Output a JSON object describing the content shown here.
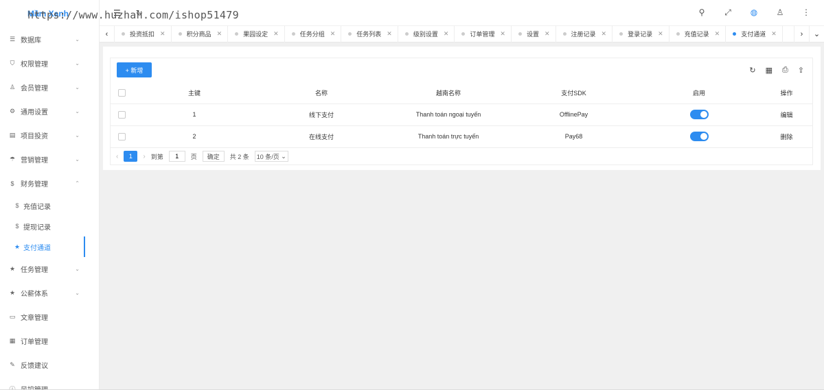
{
  "brand": "Mầm Xanh",
  "watermark": "https://www.huzhan.com/ishop51479",
  "sidebar": {
    "items": [
      {
        "label": "数据库",
        "icon": "database-icon",
        "glyph": "☰",
        "arrow": "⌄"
      },
      {
        "label": "权限管理",
        "icon": "shield-icon",
        "glyph": "⛉",
        "arrow": "⌄"
      },
      {
        "label": "会员管理",
        "icon": "user-icon",
        "glyph": "♙",
        "arrow": "⌄"
      },
      {
        "label": "通用设置",
        "icon": "gear-icon",
        "glyph": "⚙",
        "arrow": "⌄"
      },
      {
        "label": "项目投资",
        "icon": "chart-icon",
        "glyph": "▤",
        "arrow": "⌄"
      },
      {
        "label": "营销管理",
        "icon": "bell-icon",
        "glyph": "☂",
        "arrow": "⌄"
      },
      {
        "label": "财务管理",
        "icon": "dollar-icon",
        "glyph": "$",
        "arrow": "⌃"
      }
    ],
    "sub_items": [
      {
        "label": "充值记录",
        "icon": "dollar-icon",
        "glyph": "$"
      },
      {
        "label": "提现记录",
        "icon": "dollar-icon",
        "glyph": "$"
      },
      {
        "label": "支付通道",
        "icon": "star-icon",
        "glyph": "★"
      }
    ],
    "items_after": [
      {
        "label": "任务管理",
        "icon": "star-icon",
        "glyph": "★",
        "arrow": "⌄"
      },
      {
        "label": "公薪体系",
        "icon": "star-icon",
        "glyph": "★",
        "arrow": "⌄"
      },
      {
        "label": "文章管理",
        "icon": "book-icon",
        "glyph": "▭",
        "arrow": ""
      },
      {
        "label": "订单管理",
        "icon": "calendar-icon",
        "glyph": "▦",
        "arrow": ""
      },
      {
        "label": "反馈建议",
        "icon": "feedback-icon",
        "glyph": "✎",
        "arrow": ""
      },
      {
        "label": "风控管理",
        "icon": "info-icon",
        "glyph": "ⓘ",
        "arrow": "⌄"
      }
    ]
  },
  "header": {
    "menu_glyph": "☰",
    "refresh_glyph": "↻",
    "icons": [
      {
        "name": "search-icon",
        "glyph": "⚲"
      },
      {
        "name": "fullscreen-icon",
        "glyph": "⤢"
      },
      {
        "name": "globe-icon",
        "glyph": "◍"
      },
      {
        "name": "user-icon",
        "glyph": "♙"
      },
      {
        "name": "more-icon",
        "glyph": "⋮"
      }
    ]
  },
  "tabs": {
    "prev": "‹",
    "next": "›",
    "dropdown": "⌄",
    "items": [
      "投资抵扣",
      "积分商品",
      "果园设定",
      "任务分组",
      "任务列表",
      "级别设置",
      "订单管理",
      "设置",
      "注册记录",
      "登录记录",
      "充值记录",
      "支付通道"
    ],
    "active_index": 11,
    "close": "✕"
  },
  "toolbar": {
    "add_label": "+ 新增",
    "tools": [
      {
        "name": "refresh-icon",
        "glyph": "↻"
      },
      {
        "name": "columns-icon",
        "glyph": "▦"
      },
      {
        "name": "print-icon",
        "glyph": "⎙"
      },
      {
        "name": "export-icon",
        "glyph": "⇪"
      }
    ]
  },
  "table": {
    "columns": [
      "主键",
      "名称",
      "越南名称",
      "支付SDK",
      "启用",
      "操作"
    ],
    "rows": [
      {
        "id": "1",
        "name": "线下支付",
        "vn_name": "Thanh toán ngoại tuyến",
        "sdk": "OfflinePay",
        "enabled": true,
        "action": "编辑"
      },
      {
        "id": "2",
        "name": "在线支付",
        "vn_name": "Thanh toán trực tuyến",
        "sdk": "Pay68",
        "enabled": true,
        "action": "删除"
      }
    ]
  },
  "pager": {
    "prev": "‹",
    "current": "1",
    "next": "›",
    "goto_label": "到第",
    "goto_value": "1",
    "page_label": "页",
    "confirm_label": "确定",
    "total_label": "共 2 条",
    "size_label": "10 条/页",
    "size_arrow": "⌄"
  }
}
